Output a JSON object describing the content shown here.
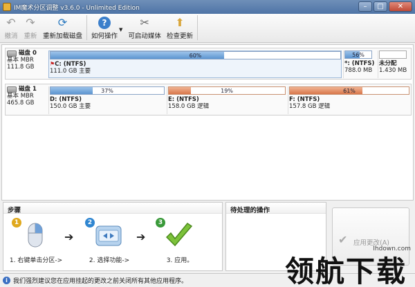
{
  "window": {
    "title": "IM魔术分区调整 v3.6.0 - Unlimited Edition",
    "controls": [
      "–",
      "□",
      "✕"
    ]
  },
  "toolbar": {
    "undo": "撤消",
    "redo": "重新",
    "reload": "重新加载磁盘",
    "help": "如何操作",
    "bootable": "可启动媒体",
    "update": "检查更新"
  },
  "disks": [
    {
      "name": "磁盘 0",
      "type": "基本 MBR",
      "size": "111.8 GB",
      "partitions": [
        {
          "name": "C: (NTFS)",
          "detail": "111.0 GB 主要",
          "percent": "60%",
          "fill": 0.6,
          "color": "blue",
          "flag": true
        },
        {
          "name": "*: (NTFS)",
          "detail": "788.0 MB",
          "percent": "56%",
          "fill": 0.56,
          "color": "blue"
        },
        {
          "name": "未分配",
          "detail": "1.430 MB",
          "percent": "",
          "fill": 0,
          "color": "none"
        }
      ]
    },
    {
      "name": "磁盘 1",
      "type": "基本 MBR",
      "size": "465.8 GB",
      "partitions": [
        {
          "name": "D: (NTFS)",
          "detail": "150.0 GB 主要",
          "percent": "37%",
          "fill": 0.37,
          "color": "blue"
        },
        {
          "name": "E: (NTFS)",
          "detail": "158.0 GB 逻辑",
          "percent": "19%",
          "fill": 0.19,
          "color": "orange"
        },
        {
          "name": "F: (NTFS)",
          "detail": "157.8 GB 逻辑",
          "percent": "61%",
          "fill": 0.61,
          "color": "orange"
        }
      ]
    }
  ],
  "steps_panel": {
    "title": "步骤",
    "steps": [
      {
        "num": "1",
        "caption": "1. 右键单击分区->"
      },
      {
        "num": "2",
        "caption": "2. 选择功能->"
      },
      {
        "num": "3",
        "caption": "3. 应用。"
      }
    ]
  },
  "pending_panel": {
    "title": "待处理的操作"
  },
  "apply_button": {
    "label": "应用更改(A)"
  },
  "status": {
    "text": "我们强烈建议您在应用挂起的更改之前关闭所有其他应用程序。"
  },
  "watermark": {
    "text": "领航下载",
    "url": "lhdown.com"
  }
}
